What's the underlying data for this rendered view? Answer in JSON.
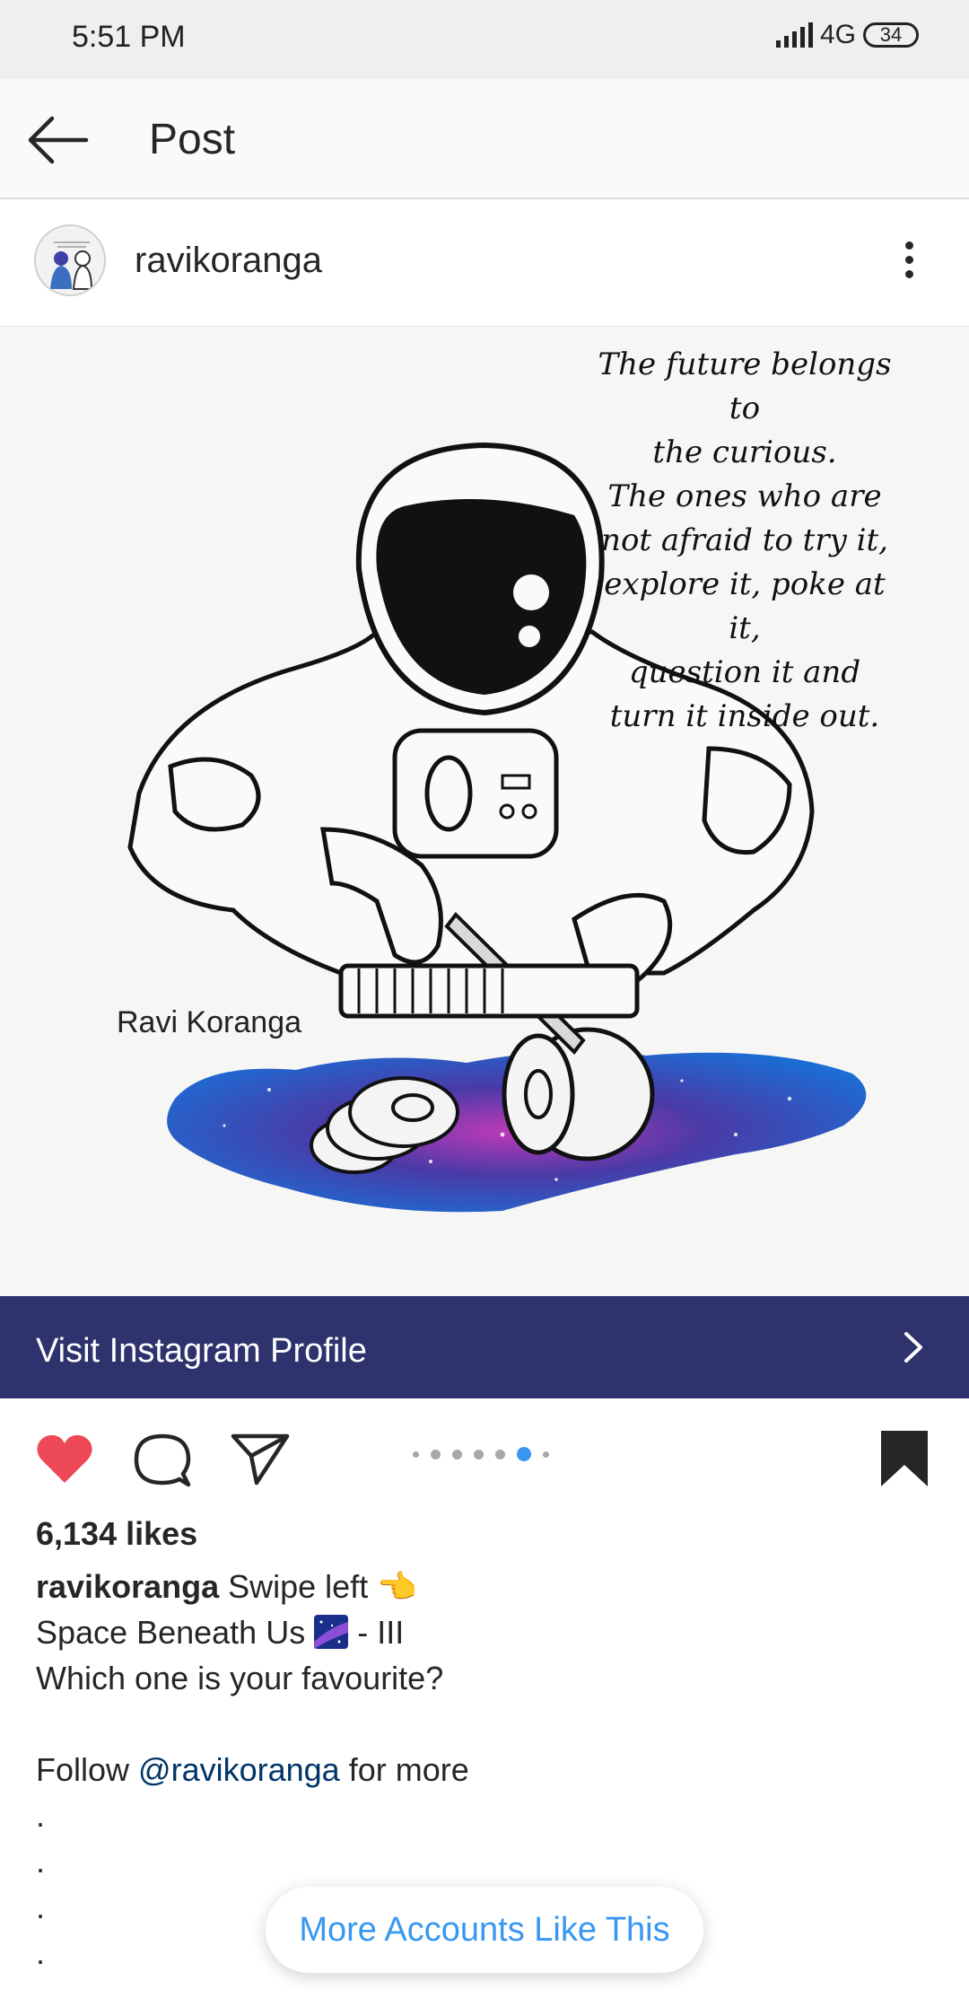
{
  "status_bar": {
    "time": "5:51 PM",
    "network": "4G",
    "battery": "34"
  },
  "app_bar": {
    "title": "Post"
  },
  "post": {
    "username": "ravikoranga",
    "image": {
      "quote_lines": [
        "The future belongs to",
        "the curious.",
        "The ones who are",
        "not afraid to try it,",
        "explore it, poke at it,",
        "question it and",
        "turn it inside out."
      ],
      "signature": "Ravi Koranga"
    },
    "profile_banner": {
      "label": "Visit Instagram Profile"
    },
    "carousel": {
      "total": 7,
      "active_index": 5
    },
    "liked": true,
    "saved": true,
    "likes": "6,134 likes",
    "caption": {
      "username": "ravikoranga",
      "line1_text": "Swipe left",
      "line1_emoji": "👈",
      "line2_text": "Space Beneath Us",
      "line2_suffix": "- III",
      "line3": "Which one is your favourite?",
      "line4_prefix": "Follow",
      "line4_mention": "@ravikoranga",
      "line4_suffix": "for more",
      "dots": [
        ".",
        ".",
        ".",
        "."
      ]
    }
  },
  "more_accounts_button": {
    "label": "More Accounts Like This"
  },
  "colors": {
    "accent": "#3897f0",
    "banner": "#2e326d",
    "like": "#ed4956"
  }
}
